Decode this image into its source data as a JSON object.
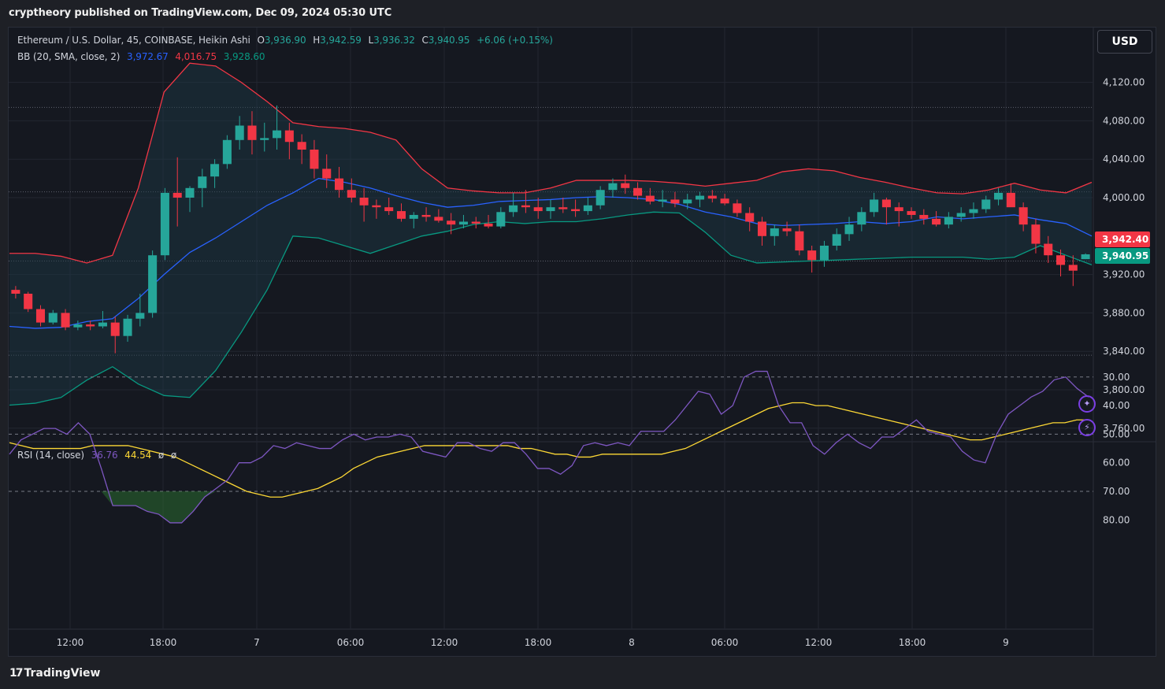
{
  "header": {
    "published_by": "cryptheory published on TradingView.com, Dec 09, 2024 05:30 UTC"
  },
  "symbol": {
    "name": "Ethereum / U.S. Dollar, 45, COINBASE, Heikin Ashi",
    "open_label": "O",
    "open": "3,936.90",
    "high_label": "H",
    "high": "3,942.59",
    "low_label": "L",
    "low": "3,936.32",
    "close_label": "C",
    "close": "3,940.95",
    "change": "+6.06 (+0.15%)"
  },
  "bb_legend": {
    "name": "BB (20, SMA, close, 2)",
    "basis": "3,972.67",
    "upper": "4,016.75",
    "lower": "3,928.60"
  },
  "rsi_legend": {
    "name": "RSI (14, close)",
    "rsi": "36.76",
    "ma": "44.54",
    "extra1": "ø",
    "extra2": "ø"
  },
  "currency": "USD",
  "price_tags": {
    "upper": "3,942.40",
    "last": "3,940.95"
  },
  "footer": {
    "brand": "TradingView",
    "brand_mark": "17"
  },
  "colors": {
    "up": "#26a69a",
    "down": "#f23645",
    "bb_upper": "#f23645",
    "bb_basis": "#2962ff",
    "bb_lower": "#089981",
    "bb_fill": "#1d3a48",
    "rsi": "#7e57c2",
    "rsi_ma": "#fdd835",
    "rsi_band": "#2a2340"
  },
  "chart_data": [
    {
      "type": "candlestick",
      "style": "Heikin Ashi",
      "x_tick_labels": [
        "12:00",
        "18:00",
        "7",
        "06:00",
        "12:00",
        "18:00",
        "8",
        "06:00",
        "12:00",
        "18:00",
        "9"
      ],
      "y_ticks": [
        4120,
        4080,
        4040,
        4000,
        3920,
        3880,
        3840,
        3800,
        3760
      ],
      "y_tick_labels": [
        "4,120.00",
        "4,080.00",
        "4,040.00",
        "4,000.00",
        "3,920.00",
        "3,880.00",
        "3,840.00",
        "3,800.00",
        "3,760.00"
      ],
      "ylim": [
        3747,
        4158
      ],
      "dotted_levels": [
        4094,
        4006,
        3934,
        3836
      ],
      "bb_upper": [
        3942,
        3942,
        3939,
        3932,
        3940,
        4010,
        4110,
        4140,
        4137,
        4120,
        4100,
        4078,
        4074,
        4072,
        4068,
        4060,
        4030,
        4010,
        4007,
        4005,
        4005,
        4010,
        4018,
        4018,
        4018,
        4017,
        4015,
        4012,
        4015,
        4018,
        4027,
        4030,
        4028,
        4021,
        4016,
        4010,
        4005,
        4004,
        4008,
        4015,
        4008,
        4005,
        4016
      ],
      "bb_basis": [
        3866,
        3864,
        3865,
        3871,
        3874,
        3895,
        3920,
        3943,
        3958,
        3975,
        3992,
        4005,
        4020,
        4016,
        4010,
        4002,
        3995,
        3990,
        3992,
        3996,
        3997,
        3998,
        4000,
        4001,
        4000,
        3998,
        3993,
        3985,
        3980,
        3973,
        3971,
        3972,
        3973,
        3975,
        3973,
        3975,
        3980,
        3978,
        3980,
        3982,
        3977,
        3973,
        3960
      ],
      "bb_lower": [
        3784,
        3786,
        3792,
        3810,
        3824,
        3806,
        3794,
        3792,
        3820,
        3860,
        3904,
        3960,
        3958,
        3950,
        3942,
        3951,
        3960,
        3965,
        3972,
        3975,
        3973,
        3975,
        3975,
        3978,
        3982,
        3985,
        3984,
        3964,
        3940,
        3932,
        3933,
        3934,
        3935,
        3936,
        3937,
        3938,
        3938,
        3938,
        3936,
        3938,
        3950,
        3940,
        3930
      ],
      "candles_note": "Approximate Heikin Ashi OHLC values (open, high, low, close) per bar in chronological order",
      "candles": [
        [
          3904,
          3908,
          3895,
          3900
        ],
        [
          3900,
          3902,
          3881,
          3884
        ],
        [
          3884,
          3888,
          3866,
          3870
        ],
        [
          3870,
          3883,
          3868,
          3880
        ],
        [
          3880,
          3884,
          3862,
          3865
        ],
        [
          3865,
          3872,
          3862,
          3868
        ],
        [
          3868,
          3872,
          3862,
          3866
        ],
        [
          3866,
          3882,
          3864,
          3870
        ],
        [
          3870,
          3876,
          3838,
          3856
        ],
        [
          3856,
          3878,
          3850,
          3874
        ],
        [
          3874,
          3900,
          3866,
          3880
        ],
        [
          3880,
          3945,
          3875,
          3940
        ],
        [
          3940,
          4010,
          3935,
          4005
        ],
        [
          4005,
          4042,
          3970,
          4000
        ],
        [
          4000,
          4012,
          3985,
          4010
        ],
        [
          4010,
          4030,
          3990,
          4022
        ],
        [
          4022,
          4040,
          4010,
          4035
        ],
        [
          4035,
          4065,
          4030,
          4060
        ],
        [
          4060,
          4085,
          4050,
          4075
        ],
        [
          4075,
          4090,
          4045,
          4060
        ],
        [
          4060,
          4078,
          4048,
          4062
        ],
        [
          4062,
          4096,
          4050,
          4070
        ],
        [
          4070,
          4078,
          4040,
          4058
        ],
        [
          4058,
          4066,
          4035,
          4050
        ],
        [
          4050,
          4060,
          4020,
          4030
        ],
        [
          4030,
          4045,
          4010,
          4020
        ],
        [
          4020,
          4032,
          4000,
          4008
        ],
        [
          4008,
          4020,
          3995,
          4000
        ],
        [
          4000,
          4010,
          3975,
          3992
        ],
        [
          3992,
          3998,
          3978,
          3990
        ],
        [
          3990,
          4000,
          3982,
          3986
        ],
        [
          3986,
          3994,
          3975,
          3978
        ],
        [
          3978,
          3985,
          3968,
          3982
        ],
        [
          3982,
          3990,
          3975,
          3980
        ],
        [
          3980,
          3988,
          3974,
          3976
        ],
        [
          3976,
          3984,
          3962,
          3972
        ],
        [
          3972,
          3982,
          3968,
          3975
        ],
        [
          3975,
          3980,
          3968,
          3973
        ],
        [
          3973,
          3982,
          3968,
          3970
        ],
        [
          3970,
          3990,
          3968,
          3985
        ],
        [
          3985,
          4005,
          3980,
          3992
        ],
        [
          3992,
          4008,
          3984,
          3990
        ],
        [
          3990,
          4000,
          3978,
          3986
        ],
        [
          3986,
          3998,
          3978,
          3990
        ],
        [
          3990,
          4000,
          3984,
          3988
        ],
        [
          3988,
          3998,
          3980,
          3986
        ],
        [
          3986,
          4000,
          3982,
          3992
        ],
        [
          3992,
          4012,
          3988,
          4008
        ],
        [
          4008,
          4020,
          4000,
          4015
        ],
        [
          4015,
          4024,
          4004,
          4010
        ],
        [
          4010,
          4016,
          3998,
          4002
        ],
        [
          4002,
          4010,
          3993,
          3996
        ],
        [
          3996,
          4008,
          3990,
          3998
        ],
        [
          3998,
          4006,
          3990,
          3994
        ],
        [
          3994,
          4004,
          3988,
          3998
        ],
        [
          3998,
          4006,
          3990,
          4002
        ],
        [
          4002,
          4008,
          3995,
          3999
        ],
        [
          3999,
          4004,
          3992,
          3994
        ],
        [
          3994,
          3998,
          3980,
          3984
        ],
        [
          3984,
          3990,
          3965,
          3975
        ],
        [
          3975,
          3980,
          3950,
          3960
        ],
        [
          3960,
          3972,
          3950,
          3968
        ],
        [
          3968,
          3975,
          3960,
          3965
        ],
        [
          3965,
          3972,
          3940,
          3945
        ],
        [
          3945,
          3950,
          3922,
          3935
        ],
        [
          3935,
          3955,
          3928,
          3950
        ],
        [
          3950,
          3968,
          3945,
          3962
        ],
        [
          3962,
          3980,
          3955,
          3972
        ],
        [
          3972,
          3990,
          3965,
          3985
        ],
        [
          3985,
          4005,
          3980,
          3998
        ],
        [
          3998,
          4000,
          3972,
          3990
        ],
        [
          3990,
          3995,
          3970,
          3986
        ],
        [
          3986,
          3990,
          3978,
          3982
        ],
        [
          3982,
          3988,
          3972,
          3978
        ],
        [
          3978,
          3986,
          3970,
          3972
        ],
        [
          3972,
          3985,
          3968,
          3980
        ],
        [
          3980,
          3990,
          3975,
          3984
        ],
        [
          3984,
          3995,
          3978,
          3988
        ],
        [
          3988,
          4002,
          3984,
          3998
        ],
        [
          3998,
          4010,
          3992,
          4005
        ],
        [
          4005,
          4015,
          3998,
          3990
        ],
        [
          3990,
          3995,
          3965,
          3972
        ],
        [
          3972,
          3978,
          3942,
          3952
        ],
        [
          3952,
          3960,
          3932,
          3940
        ],
        [
          3940,
          3946,
          3918,
          3930
        ],
        [
          3930,
          3940,
          3908,
          3924
        ],
        [
          3936,
          3942,
          3936,
          3941
        ]
      ]
    },
    {
      "type": "line",
      "name": "RSI (14, close)",
      "y_ticks": [
        80,
        70,
        60,
        50,
        40,
        30
      ],
      "y_tick_labels": [
        "80.00",
        "70.00",
        "60.00",
        "50.00",
        "40.00",
        "30.00"
      ],
      "ylim": [
        25,
        84
      ],
      "band": [
        30,
        70
      ],
      "midline": 50,
      "rsi": [
        57,
        52,
        50,
        48,
        48,
        50,
        46,
        50,
        62,
        75,
        75,
        75,
        77,
        78,
        81,
        81,
        77,
        72,
        69,
        66,
        60,
        60,
        58,
        54,
        55,
        53,
        54,
        55,
        55,
        52,
        50,
        52,
        51,
        51,
        50,
        51,
        56,
        57,
        58,
        53,
        53,
        55,
        56,
        53,
        53,
        57,
        62,
        62,
        64,
        61,
        54,
        53,
        54,
        53,
        54,
        49,
        49,
        49,
        45,
        40,
        35,
        36,
        43,
        40,
        30,
        28,
        28,
        40,
        46,
        46,
        54,
        57,
        53,
        50,
        53,
        55,
        51,
        51,
        48,
        45,
        49,
        50,
        51,
        56,
        59,
        60,
        50,
        43,
        40,
        37,
        35,
        31,
        30,
        34,
        37
      ],
      "rsi_ma": [
        53,
        54,
        55,
        55,
        55,
        55,
        55,
        54,
        54,
        54,
        54,
        55,
        56,
        57,
        58,
        60,
        62,
        64,
        66,
        68,
        70,
        71,
        72,
        72,
        71,
        70,
        69,
        67,
        65,
        62,
        60,
        58,
        57,
        56,
        55,
        54,
        54,
        54,
        54,
        54,
        54,
        54,
        54,
        55,
        55,
        56,
        57,
        57,
        58,
        58,
        57,
        57,
        57,
        57,
        57,
        57,
        56,
        55,
        53,
        51,
        49,
        47,
        45,
        43,
        41,
        40,
        39,
        39,
        40,
        40,
        41,
        42,
        43,
        44,
        45,
        46,
        47,
        48,
        49,
        50,
        51,
        52,
        52,
        51,
        50,
        49,
        48,
        47,
        46,
        46,
        45,
        45
      ]
    }
  ]
}
